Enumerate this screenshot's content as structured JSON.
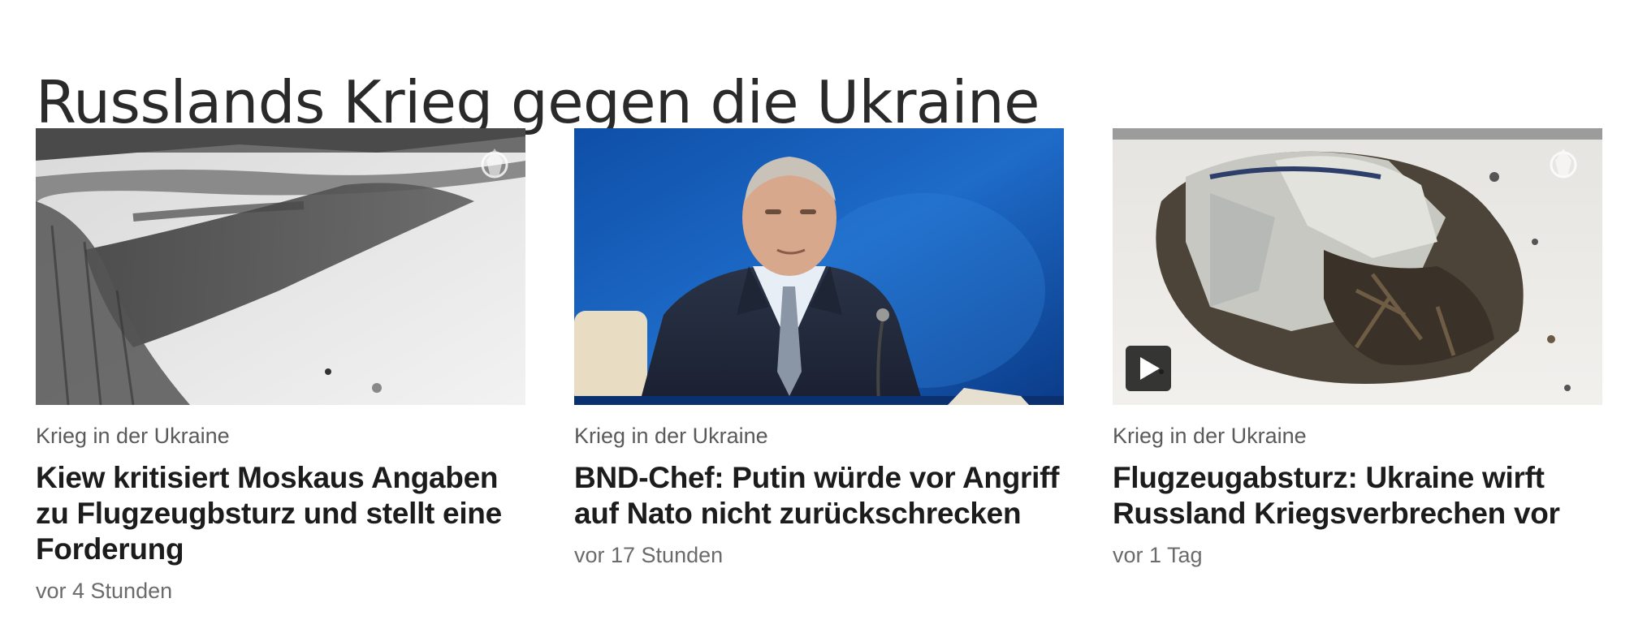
{
  "section": {
    "title": "Russlands Krieg gegen die Ukraine"
  },
  "cards": [
    {
      "kicker": "Krieg in der Ukraine",
      "headline": "Kiew kritisiert Moskaus Angaben zu Flugzeugbsturz und stellt eine Forderung",
      "timestamp": "vor 4 Stunden",
      "image": "snowy-field-crash-site"
    },
    {
      "kicker": "Krieg in der Ukraine",
      "headline": "BND-Chef: Putin würde vor Angriff auf Nato nicht zurückschrecken",
      "timestamp": "vor 17 Stunden",
      "image": "man-in-suit-blue-background"
    },
    {
      "kicker": "Krieg in der Ukraine",
      "headline": "Flugzeugabsturz: Ukraine wirft Russland Kriegsverbrechen vor",
      "timestamp": "vor 1 Tag",
      "image": "aircraft-wreckage-snow",
      "video": true
    }
  ],
  "icons": {
    "video": "play-icon",
    "watermark": "emblem-watermark-icon"
  }
}
